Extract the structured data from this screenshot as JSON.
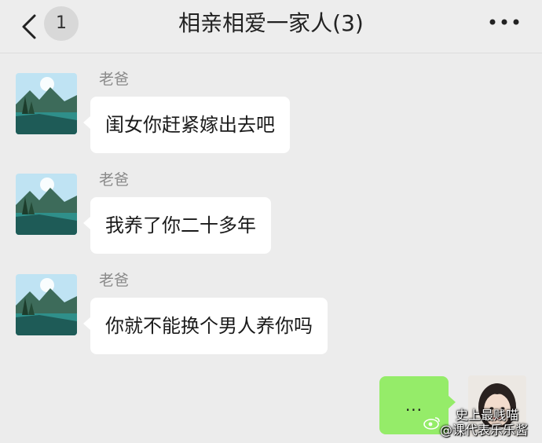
{
  "header": {
    "back_icon": "chevron-left-icon",
    "unread_count": "1",
    "title": "相亲相爱一家人(3)",
    "more_icon": "more-dots-icon"
  },
  "messages": [
    {
      "sender": "老爸",
      "text": "闺女你赶紧嫁出去吧",
      "avatar": "landscape-lake-avatar"
    },
    {
      "sender": "老爸",
      "text": "我养了你二十多年",
      "avatar": "landscape-lake-avatar"
    },
    {
      "sender": "老爸",
      "text": "你就不能换个男人养你吗",
      "avatar": "landscape-lake-avatar"
    }
  ],
  "my_message": {
    "text": "...",
    "avatar": "girl-portrait-avatar"
  },
  "watermark": {
    "icon": "weibo-icon",
    "line1": "史上最贱喵",
    "line2": "@课代表乐乐酱"
  },
  "colors": {
    "background": "#ececec",
    "incoming_bubble": "#ffffff",
    "outgoing_bubble": "#95ec69",
    "sender_name": "#8a8a8a"
  }
}
